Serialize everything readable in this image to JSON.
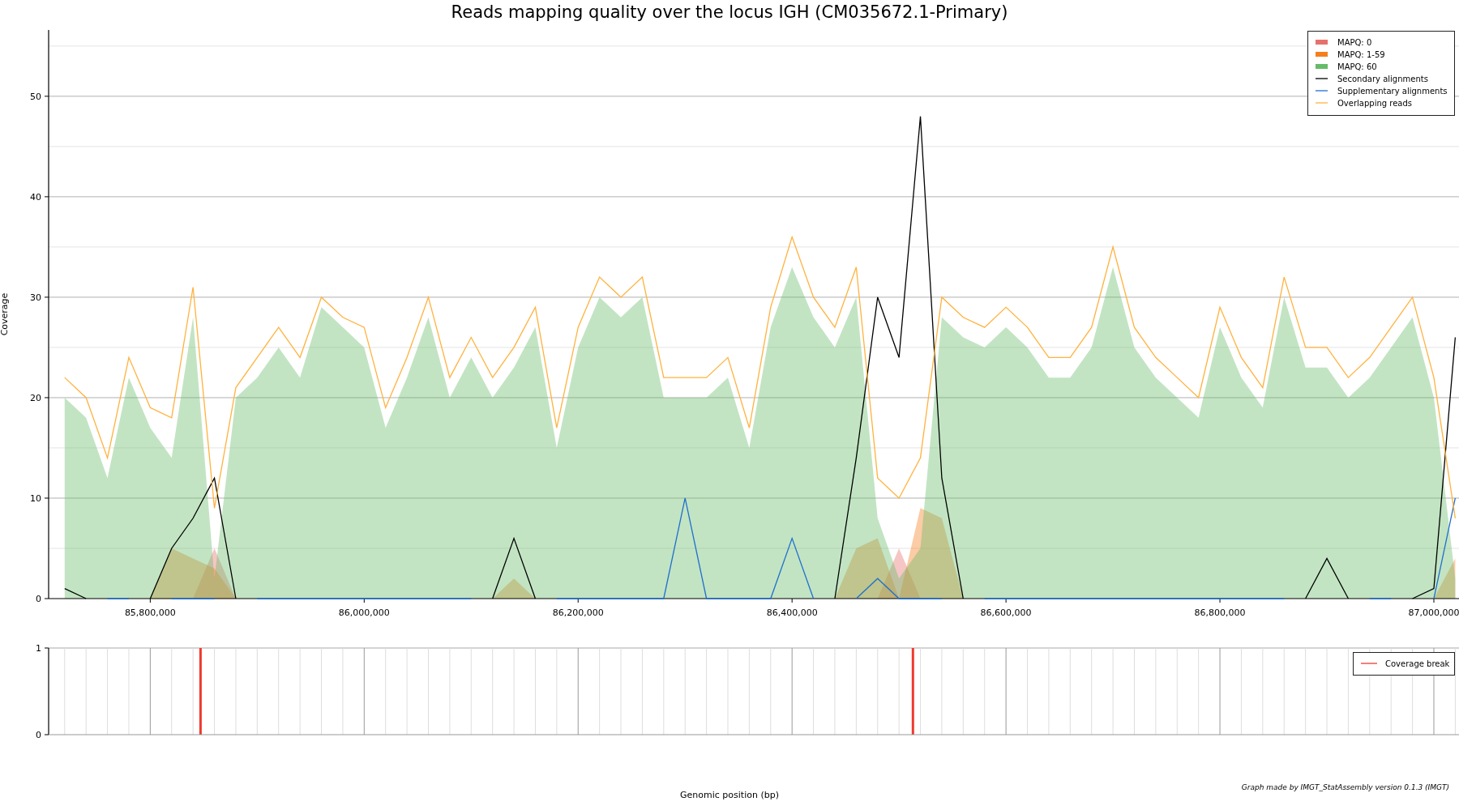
{
  "coverage_plot": {
    "areas": {
      "chart_data": {
        "type": "area",
        "title": "Reads mapping quality over the locus IGH (CM035672.1-Primary)",
        "ylabel": "Coverage",
        "xlim": [
          85705000,
          87023500
        ],
        "ylim": [
          0,
          56.6
        ],
        "grid": true,
        "legend": true,
        "xticks": [
          {
            "value": 85800000,
            "label": "85,800,000"
          },
          {
            "value": 86000000,
            "label": "86,000,000"
          },
          {
            "value": 86200000,
            "label": "86,200,000"
          },
          {
            "value": 86400000,
            "label": "86,400,000"
          },
          {
            "value": 86600000,
            "label": "86,600,000"
          },
          {
            "value": 86800000,
            "label": "86,800,000"
          },
          {
            "value": 87000000,
            "label": "87,000,000"
          }
        ],
        "yticks": [
          0,
          10,
          20,
          30,
          40,
          50
        ],
        "x": [
          85720000,
          85740000,
          85760000,
          85780000,
          85800000,
          85820000,
          85840000,
          85860000,
          85880000,
          85900000,
          85920000,
          85940000,
          85960000,
          85980000,
          86000000,
          86020000,
          86040000,
          86060000,
          86080000,
          86100000,
          86120000,
          86140000,
          86160000,
          86180000,
          86200000,
          86220000,
          86240000,
          86260000,
          86280000,
          86300000,
          86320000,
          86340000,
          86360000,
          86380000,
          86400000,
          86420000,
          86440000,
          86460000,
          86480000,
          86500000,
          86520000,
          86540000,
          86560000,
          86580000,
          86600000,
          86620000,
          86640000,
          86660000,
          86680000,
          86700000,
          86720000,
          86740000,
          86760000,
          86780000,
          86800000,
          86820000,
          86840000,
          86860000,
          86880000,
          86900000,
          86920000,
          86940000,
          86960000,
          86980000,
          87000000,
          87020000
        ],
        "series": [
          {
            "name": "MAPQ: 0",
            "color": "#e6716c",
            "values": [
              0,
              0,
              0,
              0,
              0,
              0,
              0,
              5,
              0,
              0,
              0,
              0,
              0,
              0,
              0,
              0,
              0,
              0,
              0,
              0,
              0,
              0,
              0,
              0,
              0,
              0,
              0,
              0,
              0,
              0,
              0,
              0,
              0,
              0,
              0,
              0,
              0,
              0,
              0,
              5,
              0,
              0,
              0,
              0,
              0,
              0,
              0,
              0,
              0,
              0,
              0,
              0,
              0,
              0,
              0,
              0,
              0,
              0,
              0,
              0,
              0,
              0,
              0,
              0,
              0,
              0
            ]
          },
          {
            "name": "MAPQ: 1-59",
            "color": "#f57f1f",
            "values": [
              0,
              0,
              0,
              0,
              0,
              5,
              4,
              3,
              0,
              0,
              0,
              0,
              0,
              0,
              0,
              0,
              0,
              0,
              0,
              0,
              0,
              2,
              0,
              0,
              0,
              0,
              0,
              0,
              0,
              0,
              0,
              0,
              0,
              0,
              0,
              0,
              0,
              5,
              6,
              0,
              9,
              8,
              0,
              0,
              0,
              0,
              0,
              0,
              0,
              0,
              0,
              0,
              0,
              0,
              0,
              0,
              0,
              0,
              0,
              0,
              0,
              0,
              0,
              0,
              0,
              4
            ]
          },
          {
            "name": "MAPQ: 60",
            "color": "#66bb6a",
            "values": [
              20,
              18,
              12,
              22,
              17,
              14,
              28,
              2,
              20,
              22,
              25,
              22,
              29,
              27,
              25,
              17,
              22,
              28,
              20,
              24,
              20,
              23,
              27,
              15,
              25,
              30,
              28,
              30,
              20,
              20,
              20,
              22,
              15,
              27,
              33,
              28,
              25,
              30,
              8,
              2,
              5,
              28,
              26,
              25,
              27,
              25,
              22,
              22,
              25,
              33,
              25,
              22,
              20,
              18,
              27,
              22,
              19,
              30,
              23,
              23,
              20,
              22,
              25,
              28,
              20,
              2
            ]
          }
        ]
      }
    },
    "lines": {
      "chart_data": {
        "type": "line",
        "xlim": [
          85705000,
          87023500
        ],
        "ylim": [
          0,
          56.6
        ],
        "x": [
          85720000,
          85740000,
          85760000,
          85780000,
          85800000,
          85820000,
          85840000,
          85860000,
          85880000,
          85900000,
          85920000,
          85940000,
          85960000,
          85980000,
          86000000,
          86020000,
          86040000,
          86060000,
          86080000,
          86100000,
          86120000,
          86140000,
          86160000,
          86180000,
          86200000,
          86220000,
          86240000,
          86260000,
          86280000,
          86300000,
          86320000,
          86340000,
          86360000,
          86380000,
          86400000,
          86420000,
          86440000,
          86460000,
          86480000,
          86500000,
          86520000,
          86540000,
          86560000,
          86580000,
          86600000,
          86620000,
          86640000,
          86660000,
          86680000,
          86700000,
          86720000,
          86740000,
          86760000,
          86780000,
          86800000,
          86820000,
          86840000,
          86860000,
          86880000,
          86900000,
          86920000,
          86940000,
          86960000,
          86980000,
          87000000,
          87020000
        ],
        "series": [
          {
            "name": "Secondary alignments",
            "color": "#000000",
            "values": [
              1,
              0,
              null,
              null,
              0,
              5,
              8,
              12,
              0,
              null,
              null,
              null,
              null,
              null,
              null,
              null,
              null,
              null,
              null,
              null,
              0,
              6,
              0,
              null,
              null,
              null,
              null,
              null,
              null,
              null,
              null,
              null,
              null,
              null,
              null,
              null,
              0,
              14,
              30,
              24,
              48,
              12,
              0,
              null,
              null,
              null,
              null,
              null,
              null,
              null,
              null,
              null,
              null,
              null,
              null,
              null,
              null,
              null,
              0,
              4,
              0,
              null,
              null,
              0,
              1,
              26
            ]
          },
          {
            "name": "Supplementary alignments",
            "color": "#1f6fce",
            "values": [
              null,
              null,
              0,
              0,
              null,
              0,
              0,
              0,
              null,
              0,
              0,
              0,
              0,
              0,
              0,
              0,
              0,
              0,
              0,
              0,
              null,
              null,
              null,
              0,
              0,
              0,
              0,
              0,
              0,
              10,
              0,
              0,
              0,
              0,
              6,
              0,
              null,
              0,
              2,
              0,
              0,
              0,
              null,
              0,
              0,
              0,
              0,
              0,
              0,
              0,
              0,
              0,
              0,
              0,
              0,
              0,
              0,
              0,
              null,
              null,
              null,
              0,
              0,
              null,
              0,
              10
            ]
          },
          {
            "name": "Overlapping reads",
            "color": "#ffb23e",
            "values": [
              22,
              20,
              14,
              24,
              19,
              18,
              31,
              9,
              21,
              24,
              27,
              24,
              30,
              28,
              27,
              19,
              24,
              30,
              22,
              26,
              22,
              25,
              29,
              17,
              27,
              32,
              30,
              32,
              22,
              22,
              22,
              24,
              17,
              29,
              36,
              30,
              27,
              33,
              12,
              10,
              14,
              30,
              28,
              27,
              29,
              27,
              24,
              24,
              27,
              35,
              27,
              24,
              22,
              20,
              29,
              24,
              21,
              32,
              25,
              25,
              22,
              24,
              27,
              30,
              22,
              8
            ]
          }
        ]
      }
    }
  },
  "breaks_plot": {
    "chart_data": {
      "type": "bar",
      "xlabel": "Genomic position (bp)",
      "xlim": [
        85705000,
        87023500
      ],
      "ylim": [
        0,
        1
      ],
      "yticks": [
        0,
        1
      ],
      "grid": true,
      "legend": true,
      "x": [
        85847000,
        86513000
      ],
      "series": [
        {
          "name": "Coverage break",
          "color": "#ee3a2f",
          "values": [
            1,
            1
          ]
        }
      ]
    }
  },
  "footer": "Graph made by IMGT_StatAssembly version 0.1.3 (IMGT)"
}
